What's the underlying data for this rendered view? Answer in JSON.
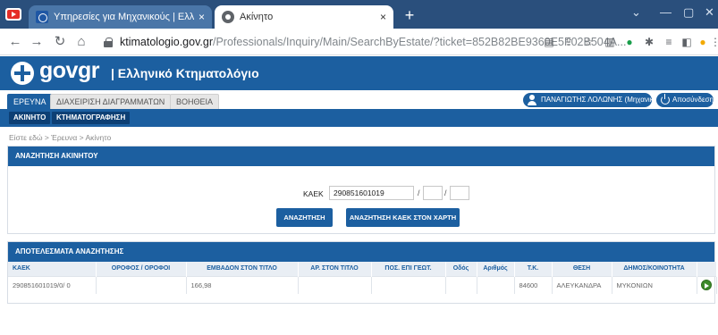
{
  "browser": {
    "tabs": [
      {
        "title": "Υπηρεσίες για Μηχανικούς | Ελλ",
        "active": true
      },
      {
        "title": "Ακίνητο",
        "active": false
      }
    ],
    "close_glyph": "×",
    "new_tab_glyph": "+",
    "url_host": "ktimatologio.gov.gr",
    "url_path": "/Professionals/Inquiry/Main/SearchByEstate/?ticket=852B82BE9360E5F02B504A...",
    "colors": {
      "tabbar": "#2a4f7c",
      "active_tab": "#4a76a8"
    }
  },
  "header": {
    "gov_word": "govgr",
    "site_title": "| Ελληνικό Κτηματολόγιο",
    "brand_color": "#1c5fa0"
  },
  "menu": {
    "items": [
      "ΕΡΕΥΝΑ",
      "ΔΙΑΧΕΙΡΙΣΗ ΔΙΑΓΡΑΜΜΑΤΩΝ",
      "ΒΟΗΘΕΙΑ"
    ],
    "active_index": 0,
    "user_label": "ΠΑΝΑΓΙΩΤΗΣ ΛΟΛΩΝΗΣ (Μηχανικός)",
    "logout_label": "Αποσύνδεση"
  },
  "subnav": {
    "items": [
      "ΑΚΙΝΗΤΟ",
      "ΚΤΗΜΑΤΟΓΡΑΦΗΣΗ"
    ]
  },
  "breadcrumb": "Είστε εδώ > Έρευνα > Ακίνητο",
  "search": {
    "title": "ΑΝΑΖΗΤΗΣΗ ΑΚΙΝΗΤΟΥ",
    "kaek_label": "ΚΑΕΚ",
    "kaek_value": "290851601019",
    "part2_value": "",
    "part3_value": "",
    "separator": "/",
    "search_button": "ΑΝΑΖΗΤΗΣΗ",
    "map_button": "ΑΝΑΖΗΤΗΣΗ ΚΑΕΚ ΣΤΟΝ ΧΑΡΤΗ"
  },
  "results": {
    "title": "ΑΠΟΤΕΛΕΣΜΑΤΑ ΑΝΑΖΗΤΗΣΗΣ",
    "columns": [
      "ΚΑΕΚ",
      "ΟΡΟΦΟΣ / ΟΡΟΦΟΙ",
      "ΕΜΒΑΔΟΝ ΣΤΟΝ ΤΙΤΛΟ",
      "ΑΡ. ΣΤΟΝ ΤΙΤΛΟ",
      "ΠΟΣ. ΕΠΙ ΓΕΩΤ.",
      "Οδός",
      "Αριθμός",
      "Τ.Κ.",
      "ΘΕΣΗ",
      "ΔΗΜΟΣ/ΚΟΙΝΟΤΗΤΑ",
      ""
    ],
    "rows": [
      [
        "290851601019/0/ 0",
        "",
        "166,98",
        "",
        "",
        "",
        "",
        "84600",
        "ΑΛΕΥΚΑΝΔΡΑ",
        "ΜΥΚΟΝΙΩΝ",
        ""
      ]
    ]
  }
}
